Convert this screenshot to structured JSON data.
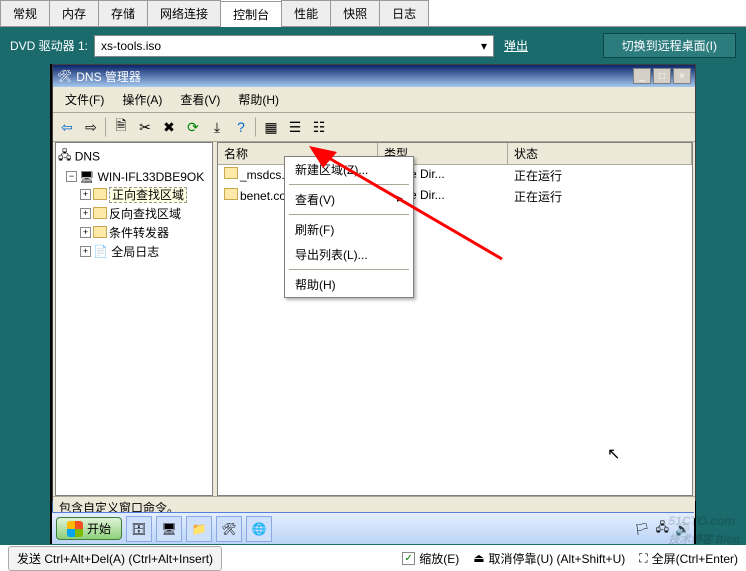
{
  "tabs": [
    "常规",
    "内存",
    "存储",
    "网络连接",
    "控制台",
    "性能",
    "快照",
    "日志"
  ],
  "active_tab_index": 4,
  "toolbar": {
    "dvd_label": "DVD 驱动器 1:",
    "dvd_value": "xs-tools.iso",
    "eject": "弹出",
    "remote": "切换到远程桌面(I)"
  },
  "dns": {
    "title": "DNS 管理器",
    "menus": [
      "文件(F)",
      "操作(A)",
      "查看(V)",
      "帮助(H)"
    ],
    "root": "DNS",
    "server": "WIN-IFL33DBE9OK",
    "nodes": [
      "正向查找区域",
      "反向查找区域",
      "条件转发器",
      "全局日志"
    ],
    "cols": [
      "名称",
      "类型",
      "状态"
    ],
    "rows": [
      {
        "name": "_msdcs.benet.com",
        "type": "Active Dir...",
        "status": "正在运行"
      },
      {
        "name": "benet.com",
        "type": "Active Dir...",
        "status": "正在运行"
      }
    ],
    "status": "包含自定义窗口命令。"
  },
  "ctx": {
    "items": [
      "新建区域(Z)...",
      "查看(V)",
      "刷新(F)",
      "导出列表(L)...",
      "帮助(H)"
    ]
  },
  "taskbar": {
    "start": "开始"
  },
  "host": {
    "send": "发送 Ctrl+Alt+Del(A) (Ctrl+Alt+Insert)",
    "scale": "缩放(E)",
    "undock": "取消停靠(U) (Alt+Shift+U)",
    "fullscreen": "全屏(Ctrl+Enter)"
  },
  "watermark": {
    "line1": "51CTO.com",
    "line2": "技术博客 Blog"
  }
}
